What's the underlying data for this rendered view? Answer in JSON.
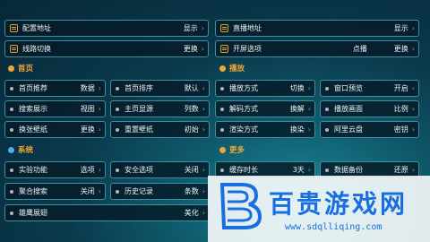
{
  "top_rows": [
    {
      "label": "配置地址",
      "value": "显示"
    },
    {
      "label": "直播地址",
      "value": "显示"
    },
    {
      "label": "线路切换",
      "value": "更换"
    },
    {
      "label": "开屏选项",
      "value": "点播",
      "extra": "更换"
    }
  ],
  "sections": {
    "home": {
      "title": "首页"
    },
    "play": {
      "title": "播放"
    },
    "system": {
      "title": "系统"
    },
    "more": {
      "title": "更多"
    }
  },
  "home_items": [
    {
      "label": "首页推荐",
      "value": "数据"
    },
    {
      "label": "首页排序",
      "value": "默认"
    },
    {
      "label": "搜索展示",
      "value": "视图"
    },
    {
      "label": "主页显源",
      "value": "列数"
    },
    {
      "label": "换张壁纸",
      "value": "更换"
    },
    {
      "label": "重置壁纸",
      "value": "初始"
    }
  ],
  "play_items": [
    {
      "label": "播放方式",
      "value": "切换"
    },
    {
      "label": "窗口预览",
      "value": "开启"
    },
    {
      "label": "解码方式",
      "value": "换解"
    },
    {
      "label": "播放画面",
      "value": "比例"
    },
    {
      "label": "渲染方式",
      "value": "换染"
    },
    {
      "label": "阿里云盘",
      "value": "密钥"
    }
  ],
  "system_items": [
    {
      "label": "实验功能",
      "value": "选项"
    },
    {
      "label": "安全选项",
      "value": "关闭"
    },
    {
      "label": "聚合搜索",
      "value": "关闭"
    },
    {
      "label": "历史记录",
      "value": "条数"
    },
    {
      "label": "雄鹰展翅",
      "value": "美化"
    }
  ],
  "more_items": [
    {
      "label": "缓存时长",
      "value": "3天"
    },
    {
      "label": "数据备份",
      "value": "还原"
    }
  ],
  "watermark": {
    "text": "百贵游戏网",
    "url": "www.sdqlliqing.com"
  },
  "colors": {
    "accent": "#f0a53a",
    "border": "#3d8fa1",
    "background": "#0a3a4c"
  }
}
